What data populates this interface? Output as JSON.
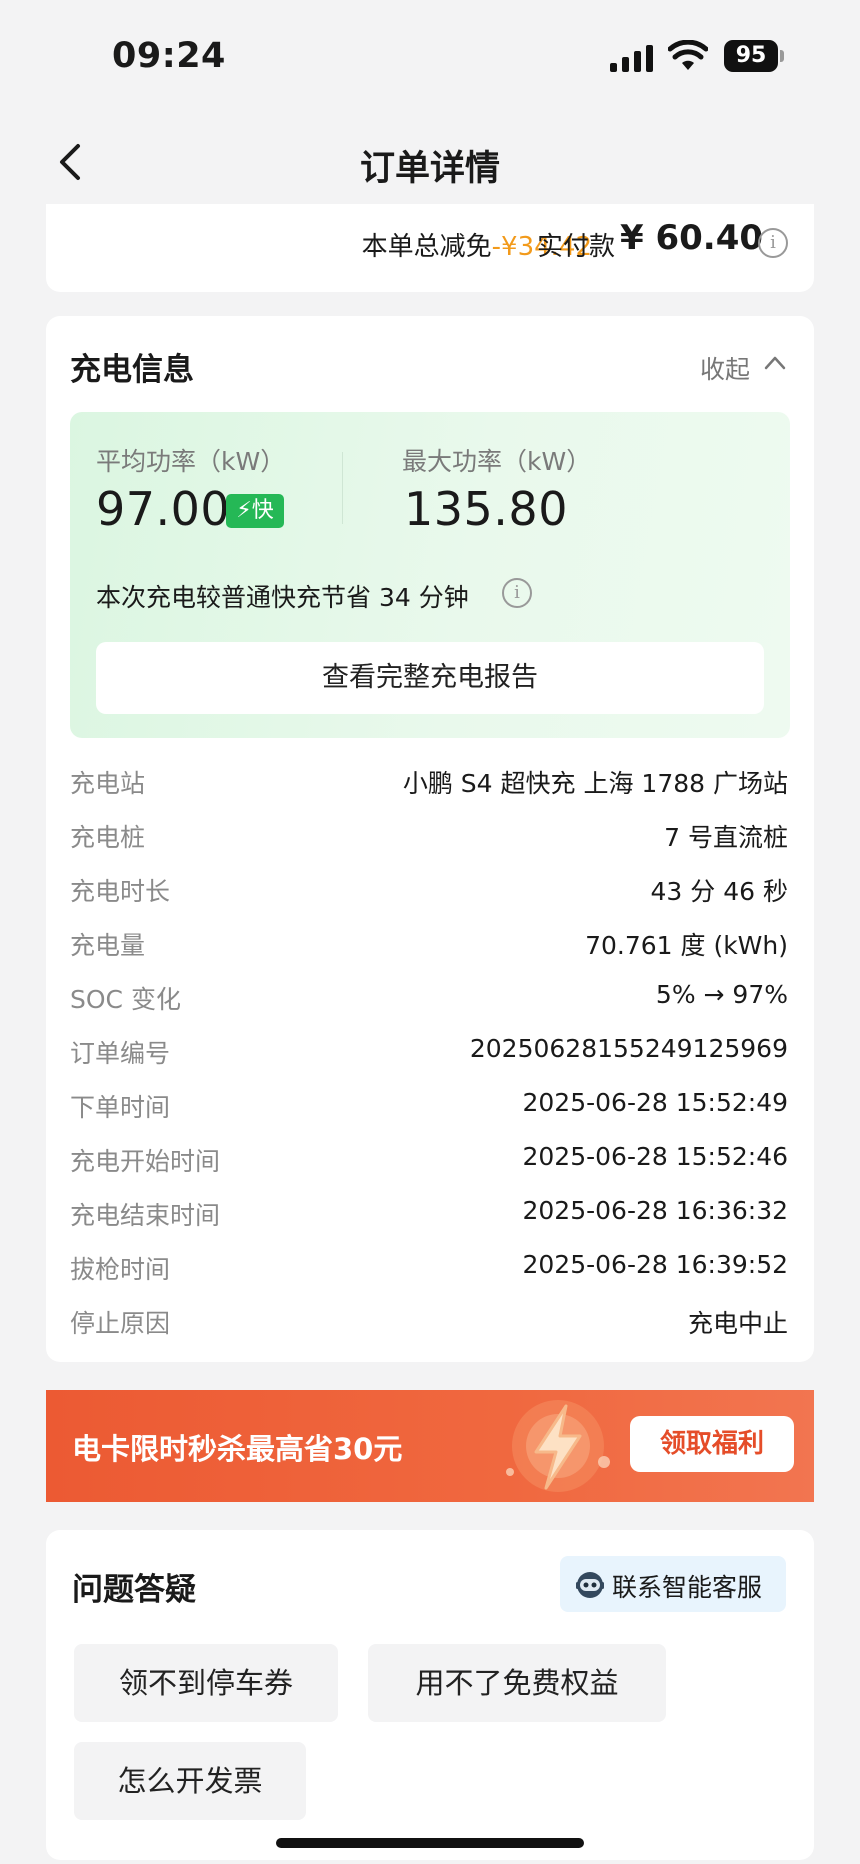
{
  "status_bar": {
    "time": "09:24",
    "battery": "95"
  },
  "nav": {
    "title": "订单详情"
  },
  "payment": {
    "discount_label": "本单总减免",
    "discount_value": "-¥34.42",
    "paid_label": "实付款",
    "paid_amount": "¥ 60.40",
    "info_glyph": "i"
  },
  "charging_info": {
    "title": "充电信息",
    "collapse_label": "收起",
    "avg_power_label": "平均功率（kW）",
    "avg_power_value": "97.00",
    "fast_badge": "快",
    "max_power_label": "最大功率（kW）",
    "max_power_value": "135.80",
    "saving_text": "本次充电较普通快充节省 34 分钟",
    "report_button": "查看完整充电报告",
    "rows": [
      {
        "label": "充电站",
        "value": "小鹏 S4 超快充 上海 1788 广场站"
      },
      {
        "label": "充电桩",
        "value": "7 号直流桩"
      },
      {
        "label": "充电时长",
        "value": "43 分 46 秒"
      },
      {
        "label": "充电量",
        "value": "70.761 度 (kWh)"
      },
      {
        "label": "SOC 变化",
        "value": "5% → 97%"
      },
      {
        "label": "订单编号",
        "value": "20250628155249125969"
      },
      {
        "label": "下单时间",
        "value": "2025-06-28 15:52:49"
      },
      {
        "label": "充电开始时间",
        "value": "2025-06-28 15:52:46"
      },
      {
        "label": "充电结束时间",
        "value": "2025-06-28 16:36:32"
      },
      {
        "label": "拔枪时间",
        "value": "2025-06-28 16:39:52"
      },
      {
        "label": "停止原因",
        "value": "充电中止"
      }
    ]
  },
  "banner": {
    "text": "电卡限时秒杀最高省30元",
    "button": "领取福利"
  },
  "faq": {
    "title": "问题答疑",
    "service_button": "联系智能客服",
    "chips": [
      "领不到停车券",
      "用不了免费权益",
      "怎么开发票"
    ]
  },
  "colors": {
    "accent_orange": "#f29a1b",
    "fast_green": "#25b856",
    "banner_red": "#ec5a33"
  }
}
